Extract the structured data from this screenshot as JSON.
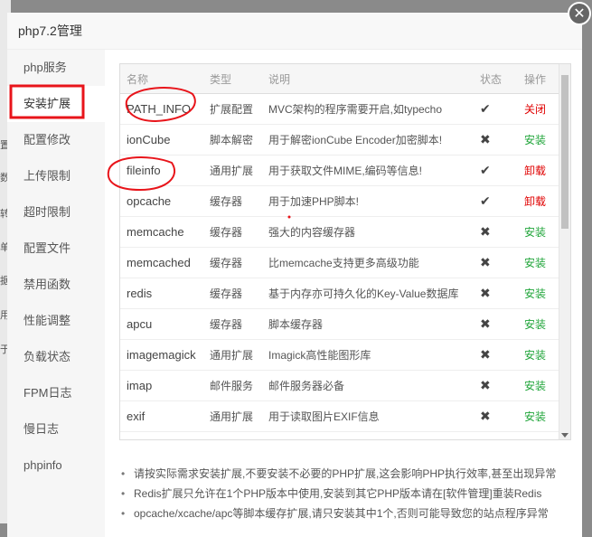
{
  "bg_fragments": [
    "置",
    "数",
    "转",
    "单",
    "据",
    "用",
    "于"
  ],
  "dialog": {
    "title": "php7.2管理",
    "close_icon": "close-icon"
  },
  "sidebar": [
    {
      "label": "php服务"
    },
    {
      "label": "安装扩展",
      "active": true
    },
    {
      "label": "配置修改"
    },
    {
      "label": "上传限制"
    },
    {
      "label": "超时限制"
    },
    {
      "label": "配置文件"
    },
    {
      "label": "禁用函数"
    },
    {
      "label": "性能调整"
    },
    {
      "label": "负载状态"
    },
    {
      "label": "FPM日志"
    },
    {
      "label": "慢日志"
    },
    {
      "label": "phpinfo"
    }
  ],
  "table": {
    "headers": [
      "名称",
      "类型",
      "说明",
      "状态",
      "操作"
    ],
    "rows": [
      {
        "name": "PATH_INFO",
        "type": "扩展配置",
        "desc": "MVC架构的程序需要开启,如typecho",
        "status": "check",
        "op": "关闭",
        "op_color": "#e00000"
      },
      {
        "name": "ionCube",
        "type": "脚本解密",
        "desc": "用于解密ionCube Encoder加密脚本!",
        "status": "x",
        "op": "安装",
        "op_color": "#20a53a"
      },
      {
        "name": "fileinfo",
        "type": "通用扩展",
        "desc": "用于获取文件MIME,编码等信息!",
        "status": "check",
        "op": "卸载",
        "op_color": "#e00000"
      },
      {
        "name": "opcache",
        "type": "缓存器",
        "desc": "用于加速PHP脚本!",
        "status": "check",
        "op": "卸载",
        "op_color": "#e00000"
      },
      {
        "name": "memcache",
        "type": "缓存器",
        "desc": "强大的内容缓存器",
        "status": "x",
        "op": "安装",
        "op_color": "#20a53a"
      },
      {
        "name": "memcached",
        "type": "缓存器",
        "desc": "比memcache支持更多高级功能",
        "status": "x",
        "op": "安装",
        "op_color": "#20a53a"
      },
      {
        "name": "redis",
        "type": "缓存器",
        "desc": "基于内存亦可持久化的Key-Value数据库",
        "status": "x",
        "op": "安装",
        "op_color": "#20a53a"
      },
      {
        "name": "apcu",
        "type": "缓存器",
        "desc": "脚本缓存器",
        "status": "x",
        "op": "安装",
        "op_color": "#20a53a"
      },
      {
        "name": "imagemagick",
        "type": "通用扩展",
        "desc": "Imagick高性能图形库",
        "status": "x",
        "op": "安装",
        "op_color": "#20a53a"
      },
      {
        "name": "imap",
        "type": "邮件服务",
        "desc": "邮件服务器必备",
        "status": "x",
        "op": "安装",
        "op_color": "#20a53a"
      },
      {
        "name": "exif",
        "type": "通用扩展",
        "desc": "用于读取图片EXIF信息",
        "status": "x",
        "op": "安装",
        "op_color": "#20a53a"
      },
      {
        "name": "",
        "type": "",
        "desc": "",
        "status": "",
        "op": "",
        "op_color": "#20a53a"
      }
    ]
  },
  "notes": [
    "请按实际需求安装扩展,不要安装不必要的PHP扩展,这会影响PHP执行效率,甚至出现异常",
    "Redis扩展只允许在1个PHP版本中使用,安装到其它PHP版本请在[软件管理]重装Redis",
    "opcache/xcache/apc等脚本缓存扩展,请只安装其中1个,否则可能导致您的站点程序异常"
  ],
  "colors": {
    "annotation": "#e8141a",
    "install": "#20a53a",
    "uninstall": "#e00000"
  }
}
